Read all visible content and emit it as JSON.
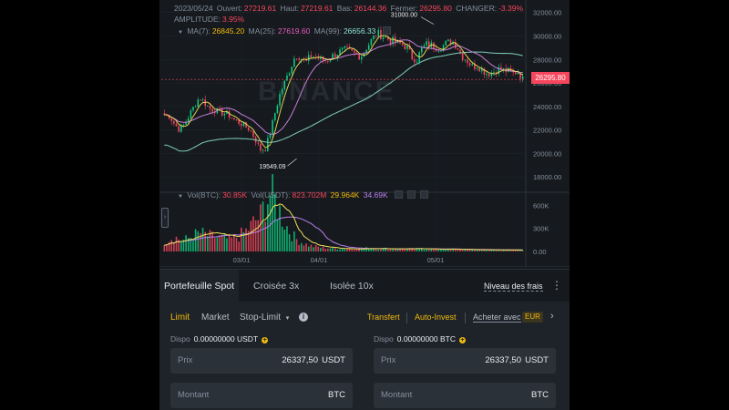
{
  "ohlc": {
    "date": "2023/05/24",
    "open_label": "Ouvert:",
    "open": "27219.61",
    "high_label": "Haut:",
    "high": "27219.61",
    "low_label": "Bas:",
    "low": "26144.36",
    "close_label": "Fermer:",
    "close": "26295.80",
    "change_label": "CHANGER:",
    "change": "-3.39%",
    "amplitude_label": "AMPLITUDE:",
    "amplitude": "3.95%"
  },
  "ma": {
    "ma7_label": "MA(7):",
    "ma7": "26845.20",
    "ma25_label": "MA(25):",
    "ma25": "27619.60",
    "ma99_label": "MA(99):",
    "ma99": "26656.33"
  },
  "volume": {
    "btc_label": "Vol(BTC):",
    "btc": "30.85K",
    "usdt_label": "Vol(USDT):",
    "usdt": "823.702M",
    "ma1": "29.964K",
    "ma2": "34.69K"
  },
  "colors": {
    "up": "#0ecb81",
    "down": "#f6465d",
    "accent": "#f0b90b",
    "ma7": "#f0e05a",
    "ma25": "#c77dd8",
    "ma99": "#7fcfb8"
  },
  "chart_data": {
    "type": "candlestick",
    "price_axis": {
      "ticks": [
        32000,
        30000,
        28000,
        26000,
        24000,
        22000,
        20000,
        18000
      ],
      "tick_labels": [
        "32000.00",
        "30000.00",
        "28000.00",
        "26000.00",
        "24000.00",
        "22000.00",
        "20000.00",
        "18000.00"
      ],
      "range": [
        17000,
        32600
      ]
    },
    "volume_axis": {
      "ticks": [
        600000,
        300000,
        0
      ],
      "tick_labels": [
        "600K",
        "300K",
        "0.00"
      ],
      "range": [
        0,
        700000
      ]
    },
    "x_tick_labels": [
      "03/01",
      "04/01",
      "05/01"
    ],
    "current_price_label": "26295.80",
    "annotations": {
      "max_label": "31000.00",
      "max_value": 31000,
      "min_label": "19549.09",
      "min_value": 19549.09
    },
    "close_anchors": [
      23300,
      23200,
      22500,
      22000,
      22500,
      23300,
      24100,
      24800,
      24300,
      23800,
      23700,
      23500,
      23400,
      23200,
      22800,
      22600,
      22300,
      22000,
      21200,
      20300,
      20400,
      21800,
      23600,
      25200,
      26200,
      27300,
      28400,
      28200,
      27700,
      28300,
      28200,
      28000,
      27900,
      28200,
      28500,
      28700,
      28800,
      28600,
      28400,
      28300,
      29000,
      29600,
      30200,
      30100,
      29800,
      29600,
      29400,
      29300,
      29100,
      28200,
      28000,
      28900,
      29300,
      29200,
      29000,
      29100,
      29400,
      29600,
      29100,
      28300,
      27900,
      27400,
      27500,
      27100,
      26800,
      26900,
      27200,
      27100,
      27000,
      26800,
      27000,
      26300
    ],
    "volume_anchors": [
      120000,
      160000,
      180000,
      150000,
      140000,
      170000,
      200000,
      230000,
      210000,
      190000,
      180000,
      170000,
      160000,
      150000,
      170000,
      200000,
      240000,
      300000,
      380000,
      430000,
      600000,
      720000,
      620000,
      480000,
      340000,
      230000,
      160000,
      120000,
      90000,
      70000,
      60000,
      50000,
      45000,
      40000,
      40000,
      38000,
      36000,
      35000,
      34000,
      33000,
      40000,
      45000,
      40000,
      38000,
      36000,
      35000,
      34000,
      33000,
      32000,
      30000,
      32000,
      34000,
      33000,
      30000,
      28000,
      27000,
      26000,
      25000,
      24000,
      23000,
      22000,
      22000,
      21000,
      20000,
      20000,
      19000,
      19000,
      18000,
      18000,
      17000,
      17000,
      16000
    ]
  },
  "tabs": {
    "spot": "Portefeuille Spot",
    "cross": "Croisée 3x",
    "isolated": "Isolée 10x",
    "fee_level": "Niveau des frais",
    "more": "⋮"
  },
  "order": {
    "limit": "Limit",
    "market": "Market",
    "stop_limit": "Stop-Limit",
    "stop_caret": "▾",
    "info": "i",
    "transfer": "Transfert",
    "auto_invest": "Auto-Invest",
    "buy_with": "Acheter avec",
    "currency": "EUR",
    "arrow": "›",
    "buy": {
      "dispo_label": "Dispo",
      "dispo_value": "0.00000000 USDT",
      "price_label": "Prix",
      "price_value": "26337,50",
      "price_unit": "USDT",
      "amount_label": "Montant",
      "amount_unit": "BTC"
    },
    "sell": {
      "dispo_label": "Dispo",
      "dispo_value": "0.00000000 BTC",
      "price_label": "Prix",
      "price_value": "26337,50",
      "price_unit": "USDT",
      "amount_label": "Montant",
      "amount_unit": "BTC"
    }
  }
}
